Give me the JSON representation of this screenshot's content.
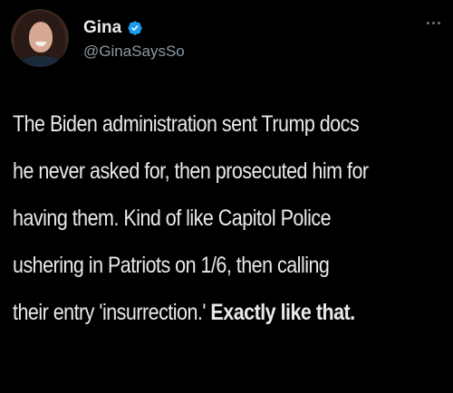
{
  "author": {
    "display_name": "Gina",
    "handle": "@GinaSaysSo",
    "verified_color": "#1d9bf0"
  },
  "tweet": {
    "lines": [
      "The Biden administration sent Trump docs",
      "he never asked for, then prosecuted him for",
      "having them. Kind of like Capitol Police",
      "ushering in Patriots on 1/6, then calling",
      "their entry 'insurrection.'"
    ],
    "emphasis": "Exactly like that."
  },
  "icons": {
    "verified": "verified-badge-icon",
    "more": "more-options-icon"
  }
}
